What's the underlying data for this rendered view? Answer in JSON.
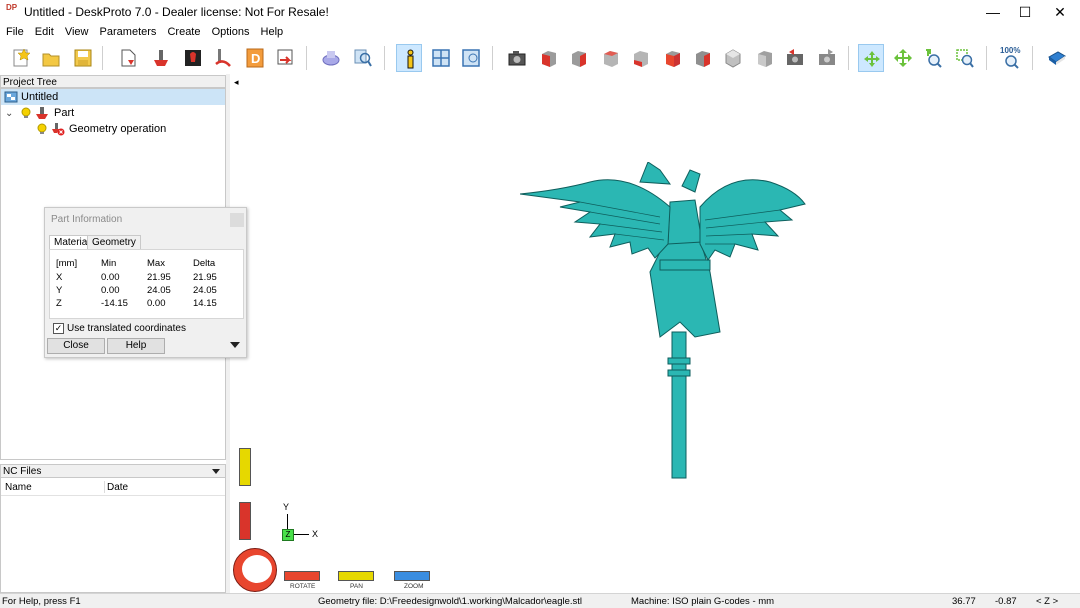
{
  "window": {
    "title": "Untitled - DeskProto 7.0 - Dealer license: Not For Resale!",
    "logo_text": "DP",
    "minimize_glyph": "—",
    "maximize_glyph": "☐",
    "close_glyph": "✕"
  },
  "menu": [
    "File",
    "Edit",
    "View",
    "Parameters",
    "Create",
    "Options",
    "Help"
  ],
  "toolbar": {
    "icons": [
      "new-project-icon",
      "open-folder-icon",
      "save-icon",
      "nc-file-icon",
      "part-icon",
      "tool-icon",
      "toolpath-icon",
      "dimension-icon",
      "export-icon",
      "render-icon",
      "zoom-part-icon",
      "info-icon",
      "tile-view-icon",
      "single-view-icon",
      "camera-icon",
      "view-front-icon",
      "view-back-icon",
      "view-left-icon",
      "view-right-icon",
      "view-top-icon",
      "view-bottom-icon",
      "view-iso-icon",
      "view-other-icon",
      "undo-view-icon",
      "redo-view-icon",
      "rotate-icon",
      "pan-icon",
      "zoom-icon",
      "zoom-window-icon",
      "zoom-100-icon",
      "book-icon"
    ],
    "zoom100_label": "100%"
  },
  "project_tree": {
    "title": "Project Tree",
    "items": [
      {
        "label": "Untitled",
        "icon": "project-icon"
      },
      {
        "label": "Part",
        "icon": "part-icon"
      },
      {
        "label": "Geometry operation",
        "icon": "operation-icon"
      }
    ],
    "expand_glyph": "⌄"
  },
  "nc_files": {
    "title": "NC Files",
    "columns": [
      "Name",
      "Date"
    ]
  },
  "part_info": {
    "title": "Part Information",
    "tabs": [
      "Material",
      "Geometry"
    ],
    "headers": [
      "[mm]",
      "Min",
      "Max",
      "Delta"
    ],
    "rows": [
      {
        "axis": "X",
        "min": "0.00",
        "max": "21.95",
        "delta": "21.95"
      },
      {
        "axis": "Y",
        "min": "0.00",
        "max": "24.05",
        "delta": "24.05"
      },
      {
        "axis": "Z",
        "min": "-14.15",
        "max": "0.00",
        "delta": "14.15"
      }
    ],
    "use_translated_label": "Use translated coordinates",
    "use_translated_checked": true,
    "checkmark": "✓",
    "close_label": "Close",
    "help_label": "Help"
  },
  "viewport": {
    "model_color": "#2bb7b3",
    "axis_y": "Y",
    "axis_x": "X",
    "axis_z": "Z",
    "collapse_glyph": "◂",
    "rotate_label": "ROTATE",
    "pan_label": "PAN",
    "zoom_label": "ZOOM"
  },
  "status": {
    "help": "For Help, press F1",
    "geometry_file": "Geometry file: D:\\Freedesignwold\\1.working\\Malcador\\eagle.stl",
    "machine": "Machine: ISO plain G-codes - mm",
    "coord1": "36.77",
    "coord2": "-0.87",
    "axis_indicator": "< Z >"
  }
}
